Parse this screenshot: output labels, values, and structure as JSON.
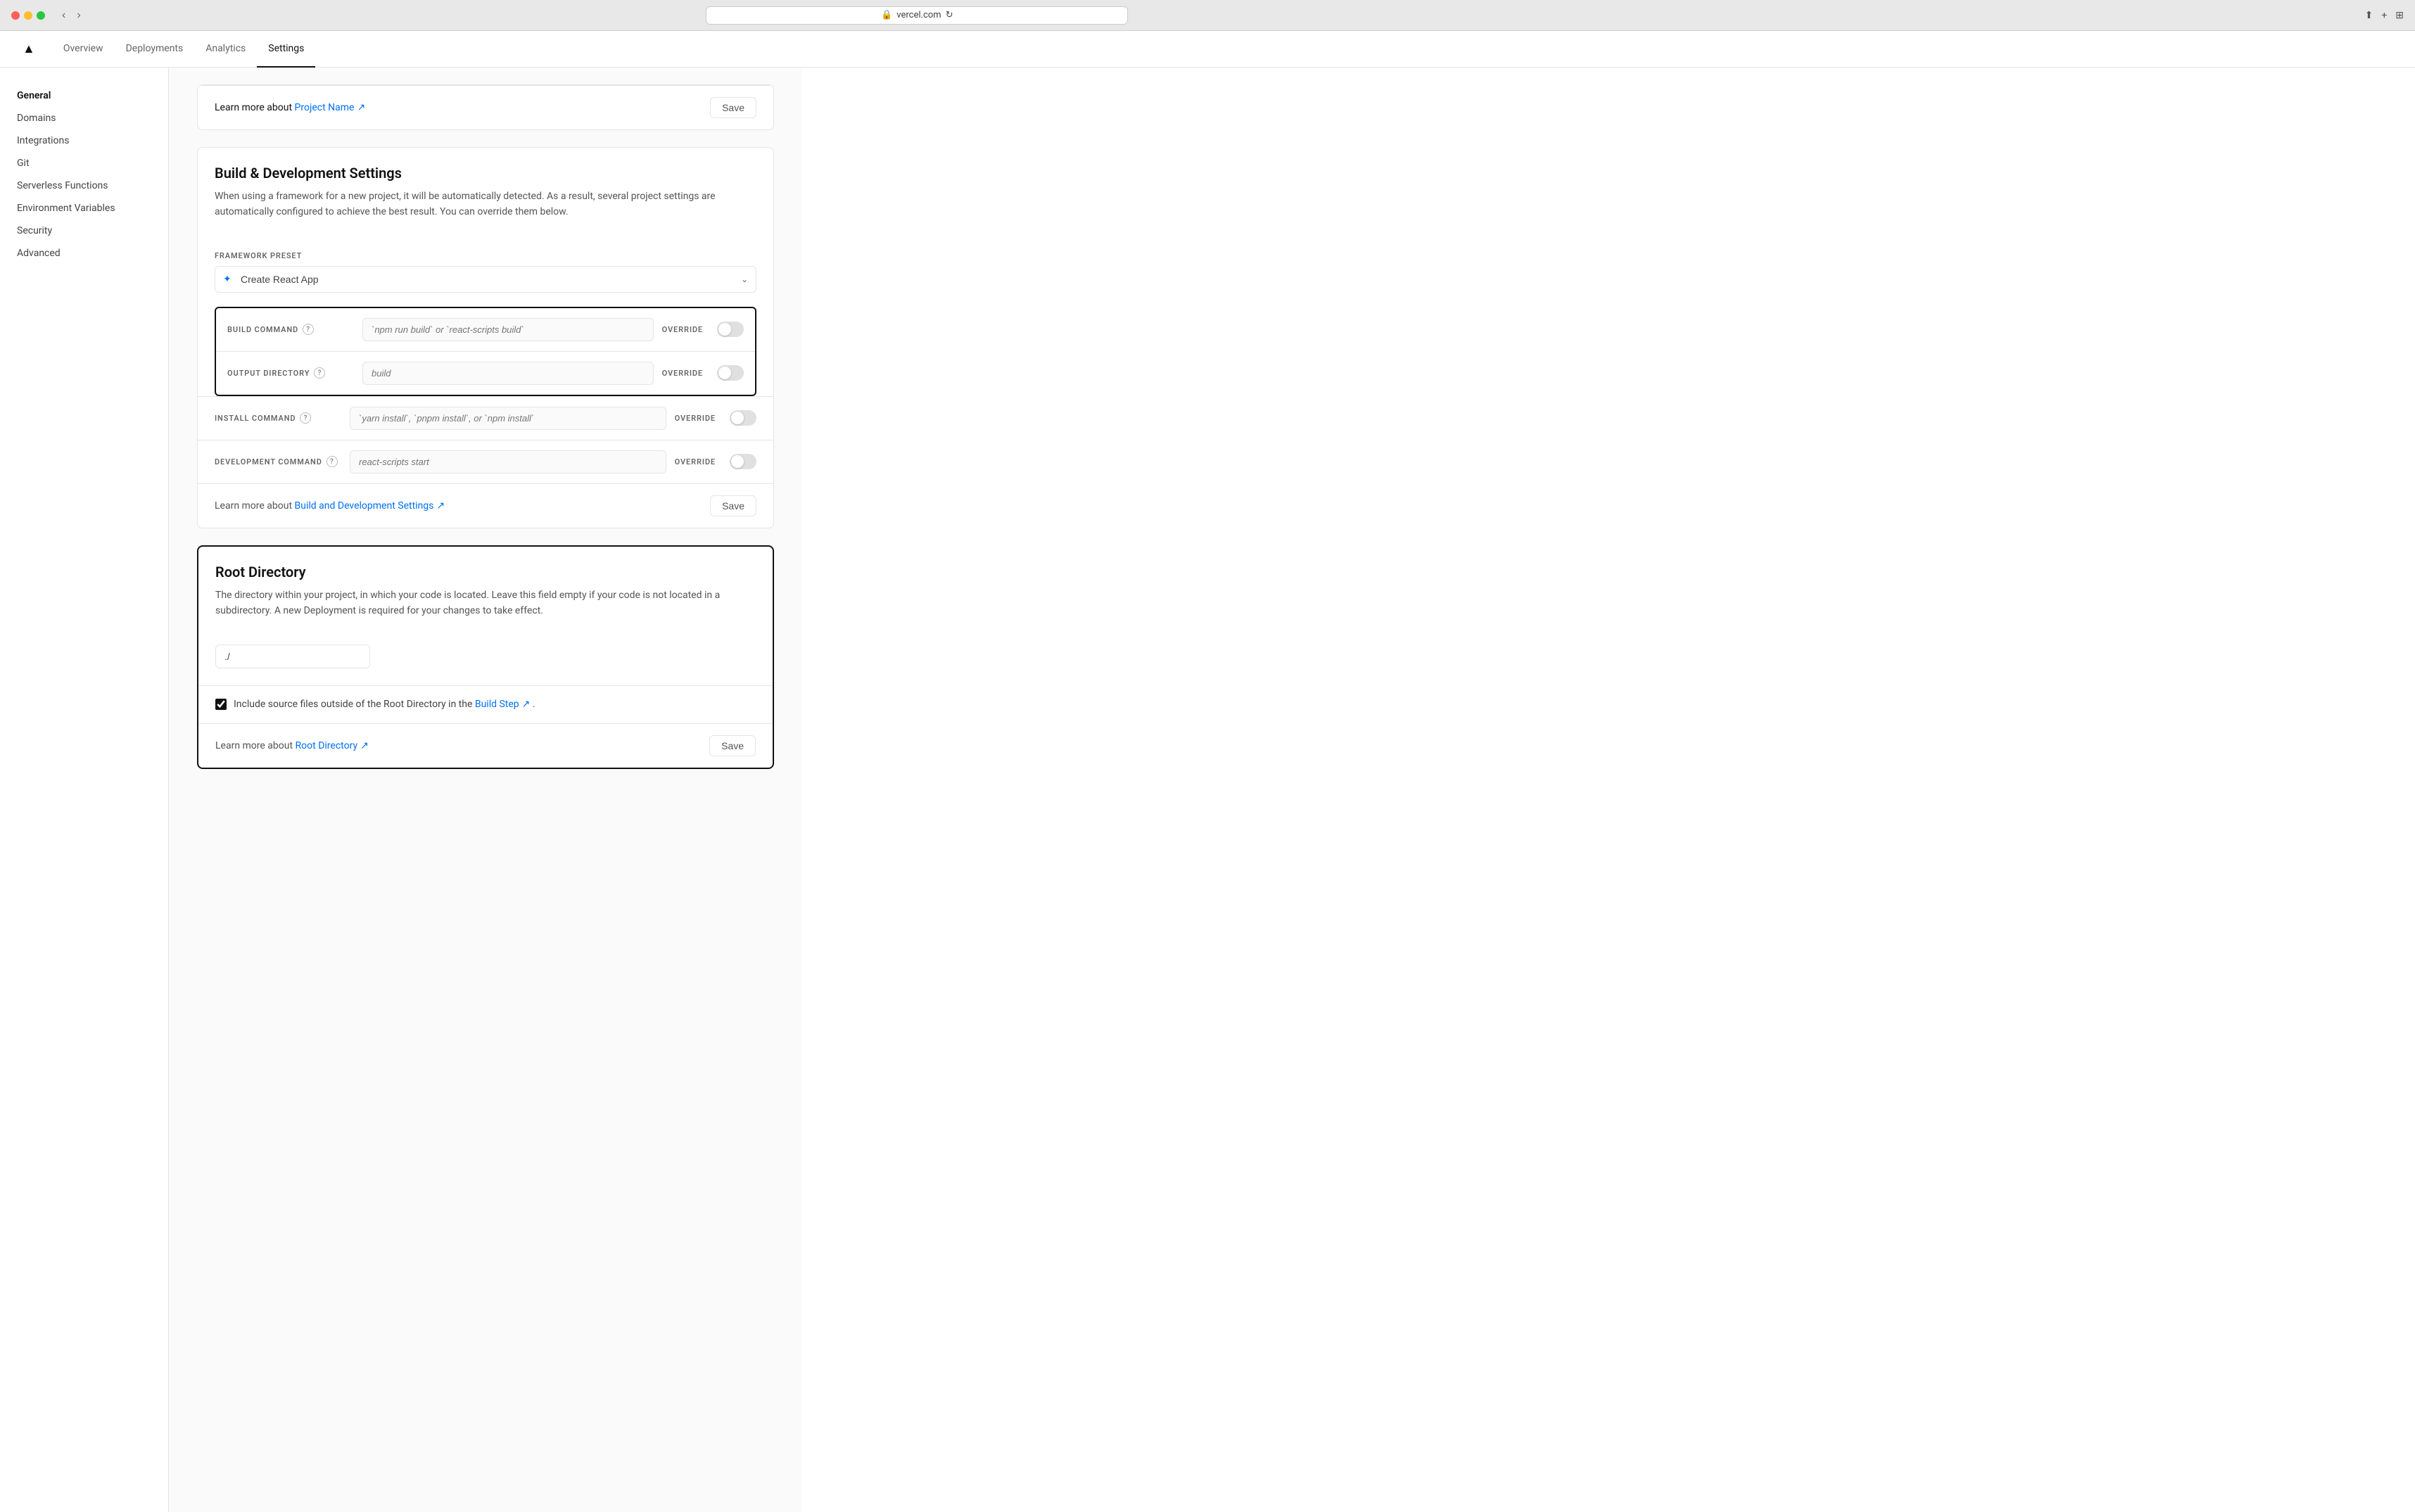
{
  "browser": {
    "url": "vercel.com",
    "lock_icon": "🔒"
  },
  "topNav": {
    "logo": "▲",
    "tabs": [
      {
        "label": "Overview",
        "active": false
      },
      {
        "label": "Deployments",
        "active": false
      },
      {
        "label": "Analytics",
        "active": false
      },
      {
        "label": "Settings",
        "active": true
      }
    ]
  },
  "sidebar": {
    "items": [
      {
        "label": "General",
        "active": true
      },
      {
        "label": "Domains",
        "active": false
      },
      {
        "label": "Integrations",
        "active": false
      },
      {
        "label": "Git",
        "active": false
      },
      {
        "label": "Serverless Functions",
        "active": false
      },
      {
        "label": "Environment Variables",
        "active": false
      },
      {
        "label": "Security",
        "active": false
      },
      {
        "label": "Advanced",
        "active": false
      }
    ]
  },
  "topCard": {
    "learnMoreText": "Learn more about",
    "learnMoreLink": "Project Name",
    "saveLabel": "Save"
  },
  "buildCard": {
    "title": "Build & Development Settings",
    "description": "When using a framework for a new project, it will be automatically detected. As a result, several project settings are automatically configured to achieve the best result. You can override them below.",
    "frameworkPresetLabel": "FRAMEWORK PRESET",
    "frameworkPresetValue": "Create React App",
    "commands": [
      {
        "label": "BUILD COMMAND",
        "placeholder": "`npm run build` or `react-scripts build`",
        "overrideLabel": "OVERRIDE",
        "toggleOn": false,
        "highlighted": true
      },
      {
        "label": "OUTPUT DIRECTORY",
        "placeholder": "build",
        "overrideLabel": "OVERRIDE",
        "toggleOn": false,
        "highlighted": true
      },
      {
        "label": "INSTALL COMMAND",
        "placeholder": "`yarn install`, `pnpm install`, or `npm install`",
        "overrideLabel": "OVERRIDE",
        "toggleOn": false,
        "highlighted": false
      },
      {
        "label": "DEVELOPMENT COMMAND",
        "placeholder": "react-scripts start",
        "overrideLabel": "OVERRIDE",
        "toggleOn": false,
        "highlighted": false
      }
    ],
    "learnMoreText": "Learn more about",
    "learnMoreLink": "Build and Development Settings",
    "saveLabel": "Save"
  },
  "rootDirCard": {
    "title": "Root Directory",
    "description": "The directory within your project, in which your code is located. Leave this field empty if your code is not located in a subdirectory. A new Deployment is required for your changes to take effect.",
    "inputValue": "./",
    "checkboxLabel": "Include source files outside of the Root Directory in the",
    "checkboxLinkText": "Build Step",
    "checkboxChecked": true,
    "learnMoreText": "Learn more about",
    "learnMoreLink": "Root Directory",
    "saveLabel": "Save"
  },
  "icons": {
    "externalLink": "↗",
    "chevronDown": "⌄",
    "lock": "🔒",
    "reload": "↻",
    "share": "⬆",
    "newTab": "+",
    "grid": "⊞",
    "back": "‹",
    "forward": "›",
    "help": "?",
    "gear": "⚙",
    "react": "✦"
  }
}
